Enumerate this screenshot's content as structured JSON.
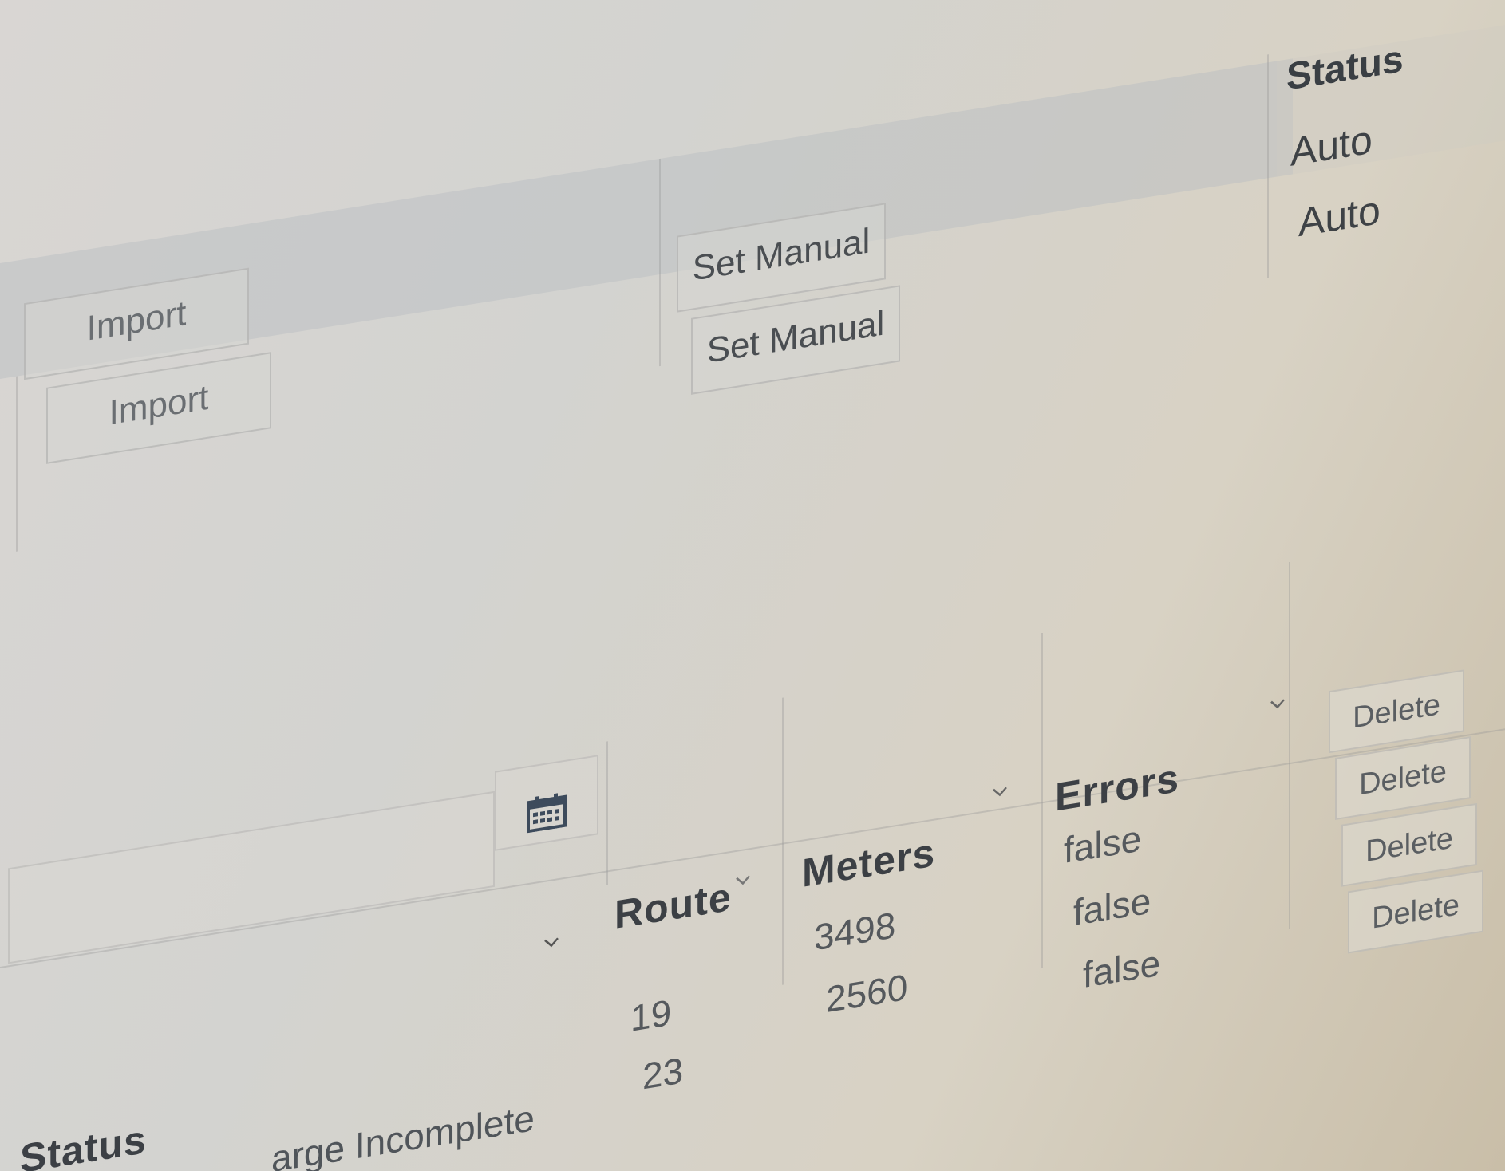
{
  "top_table": {
    "status_header": "Status",
    "import_buttons": [
      "Import",
      "Import"
    ],
    "set_manual_buttons": [
      "Set Manual",
      "Set Manual"
    ],
    "status_values": [
      "Auto",
      "Auto"
    ]
  },
  "bottom_table": {
    "headers": {
      "status": "Status",
      "route": "Route",
      "meters": "Meters",
      "errors": "Errors"
    },
    "status_partial": "arge Incomplete",
    "routes": [
      "19",
      "23"
    ],
    "meters": [
      "3498",
      "2560"
    ],
    "errors": [
      "false",
      "false",
      "false"
    ],
    "delete_buttons": [
      "Delete",
      "Delete",
      "Delete",
      "Delete"
    ]
  },
  "icons": {
    "date_filter": "calendar-icon",
    "sort": "chevron-down-icon"
  },
  "colors": {
    "header_band": "#b9bcc2",
    "text": "#3e4246"
  }
}
